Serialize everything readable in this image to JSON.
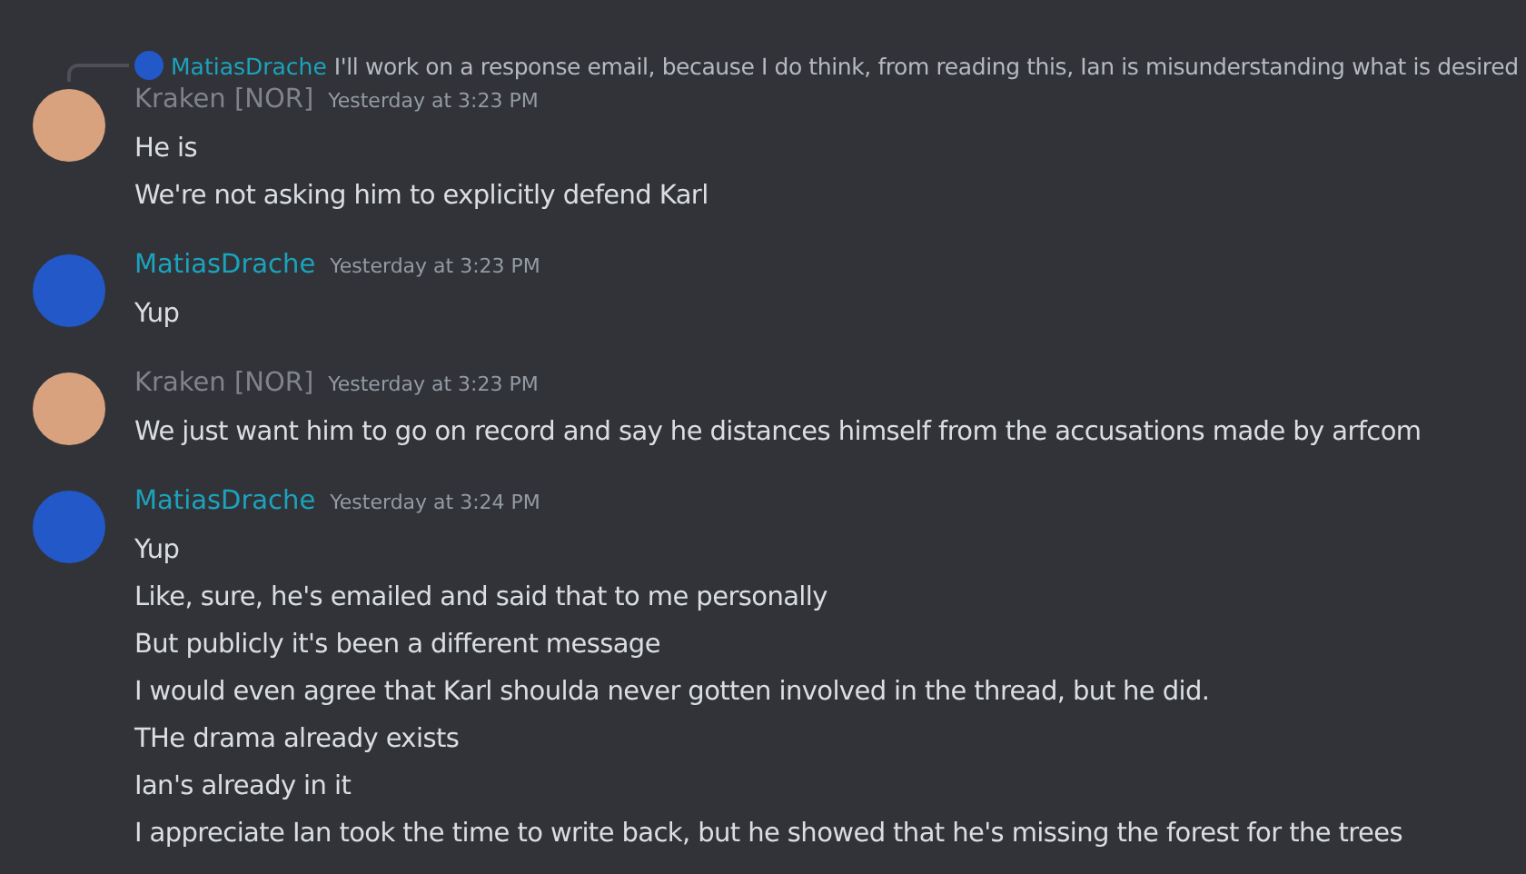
{
  "messages": [
    {
      "author": "Kraken [NOR]",
      "color": "#80838c",
      "avatar": {
        "color": "#d9a27f"
      },
      "timestamp": "Yesterday at 3:23 PM",
      "reply": {
        "author": "MatiasDrache",
        "color": "#1ba3bd",
        "avatar": {
          "color": "#2358c9"
        },
        "text": "I'll work on a response email, because I do think, from reading this, Ian is misunderstanding what is desired"
      },
      "lines": [
        "He is",
        "We're not asking him to explicitly defend Karl"
      ]
    },
    {
      "author": "MatiasDrache",
      "color": "#1ba3bd",
      "avatar": {
        "color": "#2358c9"
      },
      "timestamp": "Yesterday at 3:23 PM",
      "lines": [
        "Yup"
      ]
    },
    {
      "author": "Kraken [NOR]",
      "color": "#80838c",
      "avatar": {
        "color": "#d9a27f"
      },
      "timestamp": "Yesterday at 3:23 PM",
      "lines": [
        "We just want him to go on record and say he distances himself from the accusations made by arfcom"
      ]
    },
    {
      "author": "MatiasDrache",
      "color": "#1ba3bd",
      "avatar": {
        "color": "#2358c9"
      },
      "timestamp": "Yesterday at 3:24 PM",
      "lines": [
        "Yup",
        "Like, sure, he's emailed and said that to me personally",
        "But publicly it's been a different message",
        "I would even agree that Karl shoulda never gotten involved in the thread, but he did.",
        "THe drama already exists",
        "Ian's already in it",
        "I appreciate Ian took the time to write back, but he showed that he's missing the forest for the trees"
      ]
    }
  ]
}
